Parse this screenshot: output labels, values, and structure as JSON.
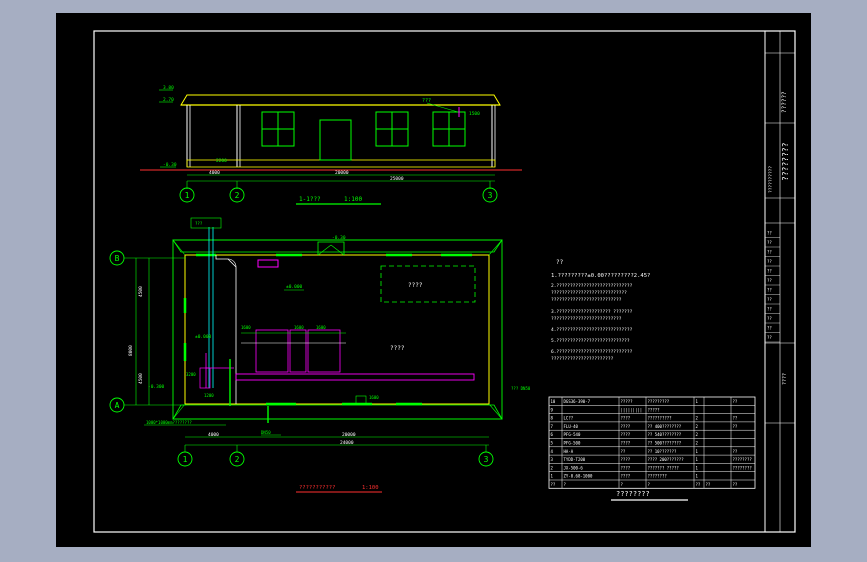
{
  "elevation": {
    "title": "1-1???",
    "scale": "1:100",
    "window_tag": "???",
    "tag_dim": "1500",
    "dims": [
      "4000",
      "20000",
      "25000"
    ],
    "level_labels": [
      "3.80",
      "2.70",
      "-0.30"
    ],
    "side_label": "2200",
    "axes": [
      "1",
      "2",
      "3"
    ]
  },
  "plan": {
    "title": "???????????",
    "scale": "1:100",
    "rows": [
      "B",
      "A"
    ],
    "axes": [
      "1",
      "2",
      "3"
    ],
    "cols_dim": [
      "4000",
      "20000"
    ],
    "total_dim": "24000",
    "depth_dims": [
      "4500",
      "8000",
      "4500"
    ],
    "room_main": "????",
    "room_top": "????",
    "cabinet_labels": [
      "1600",
      "1600",
      "1600"
    ],
    "levels": [
      "±0.000",
      "-0.300",
      "-0.450"
    ],
    "side_notes": [
      "3200",
      "1200"
    ],
    "bottom_notes": [
      "1000*1000mm????????",
      "DN50"
    ],
    "right_note": "??? DN50",
    "door_mark": "-0.30",
    "small_tags": [
      "±0.000",
      "???",
      "1600"
    ]
  },
  "notes": {
    "heading": "??",
    "lines": [
      "1.?????????±0.00?????????2.45?",
      "2.????????????????????????????",
      "  ????????????????????????????",
      "  ??????????????????????????",
      "3.???????????????????? ???????",
      "  ??????????????????????????",
      "4.????????????????????????????",
      "5.???????????????????????????",
      "6.????????????????????????????",
      "  ???????????????????????"
    ]
  },
  "table": {
    "title": "????????",
    "rows": [
      [
        "10",
        "DGS36-390-7",
        "?????",
        "?????????",
        "1",
        "",
        "??"
      ],
      [
        "9",
        "",
        "|||||||||",
        "?????",
        "",
        "",
        ""
      ],
      [
        "8",
        "LC??",
        "????",
        "??????????",
        "2",
        "",
        "??"
      ],
      [
        "7",
        "FLU-40",
        "????",
        "?? 400????????",
        "2",
        "",
        "??"
      ],
      [
        "6",
        "PFG-540",
        "????",
        "?? 540????????",
        "2",
        "",
        ""
      ],
      [
        "5",
        "PFG-500",
        "????",
        "?? 500????????",
        "2",
        "",
        ""
      ],
      [
        "4",
        "HA-A",
        "??",
        "?? 10???????",
        "1",
        "",
        "??"
      ],
      [
        "3",
        "TYDD-T200",
        "????",
        "???? 200???????",
        "1",
        "",
        "????????"
      ],
      [
        "2",
        "JX-500-6",
        "????",
        "??????? ?????",
        "1",
        "",
        "????????"
      ],
      [
        "1",
        "ZY-0.68-1000",
        "????",
        "????????",
        "1",
        "",
        ""
      ],
      [
        "??",
        "?",
        "?",
        "?",
        "??",
        "??",
        "??"
      ]
    ]
  },
  "title_block": {
    "project": "??????????",
    "company": "??????",
    "drawing_name": "????????",
    "cells": [
      "??",
      "??",
      "??",
      "??",
      "??",
      "??",
      "??",
      "??",
      "??",
      "??",
      "??",
      "??"
    ],
    "drawing_no": "????"
  }
}
